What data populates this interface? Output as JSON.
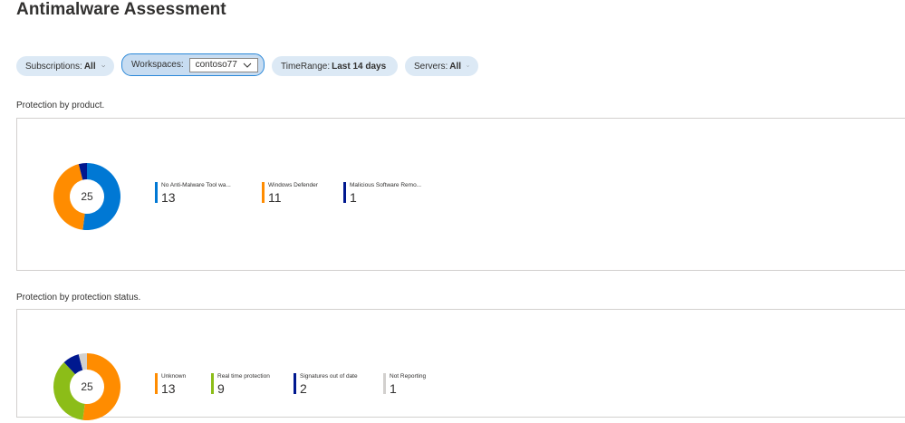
{
  "page": {
    "title": "Antimalware Assessment"
  },
  "filters": {
    "subscriptions": {
      "label": "Subscriptions:",
      "value": "All"
    },
    "workspaces": {
      "label": "Workspaces:",
      "value": "contoso77"
    },
    "timerange": {
      "label": "TimeRange:",
      "value": "Last 14 days"
    },
    "servers": {
      "label": "Servers:",
      "value": "All"
    }
  },
  "sections": [
    {
      "label": "Protection by product.",
      "total": "25",
      "items": [
        {
          "name": "No Anti-Malware Tool wa...",
          "value": "13",
          "color": "#0078d4"
        },
        {
          "name": "Windows Defender",
          "value": "11",
          "color": "#ff8c00"
        },
        {
          "name": "Malicious Software Remo...",
          "value": "1",
          "color": "#00188f"
        }
      ]
    },
    {
      "label": "Protection by protection status.",
      "total": "25",
      "items": [
        {
          "name": "Unknown",
          "value": "13",
          "color": "#ff8c00"
        },
        {
          "name": "Real time protection",
          "value": "9",
          "color": "#8cbd18"
        },
        {
          "name": "Signatures out of date",
          "value": "2",
          "color": "#00188f"
        },
        {
          "name": "Not Reporting",
          "value": "1",
          "color": "#d2d0ce"
        }
      ]
    }
  ],
  "chart_data": [
    {
      "type": "pie",
      "title": "Protection by product.",
      "categories": [
        "No Anti-Malware Tool wa...",
        "Windows Defender",
        "Malicious Software Remo..."
      ],
      "values": [
        13,
        11,
        1
      ],
      "colors": [
        "#0078d4",
        "#ff8c00",
        "#00188f"
      ],
      "center_label": "25"
    },
    {
      "type": "pie",
      "title": "Protection by protection status.",
      "categories": [
        "Unknown",
        "Real time protection",
        "Signatures out of date",
        "Not Reporting"
      ],
      "values": [
        13,
        9,
        2,
        1
      ],
      "colors": [
        "#ff8c00",
        "#8cbd18",
        "#00188f",
        "#d2d0ce"
      ],
      "center_label": "25"
    }
  ]
}
